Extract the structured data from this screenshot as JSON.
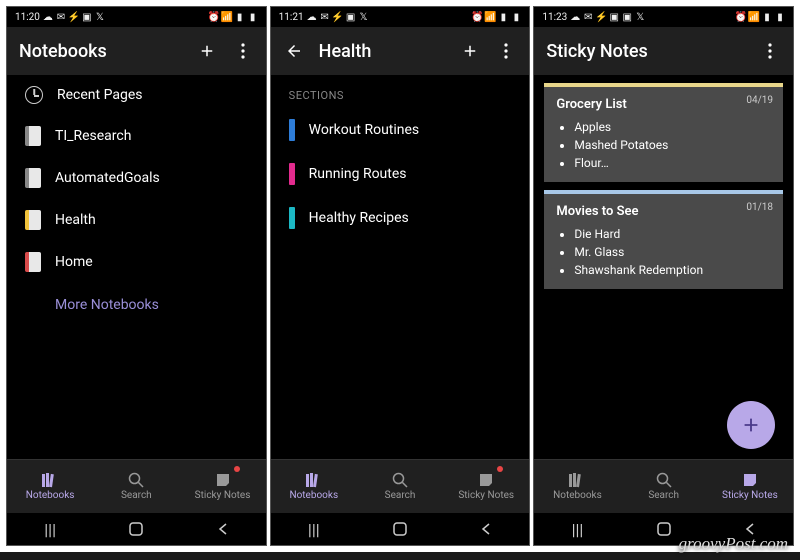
{
  "watermark": "groovyPost.com",
  "screens": {
    "notebooks": {
      "time": "11:20",
      "title": "Notebooks",
      "recent_label": "Recent Pages",
      "items": [
        {
          "label": "TI_Research",
          "color": "gray"
        },
        {
          "label": "AutomatedGoals",
          "color": "gray"
        },
        {
          "label": "Health",
          "color": "yellow"
        },
        {
          "label": "Home",
          "color": "red"
        }
      ],
      "more_label": "More Notebooks",
      "bottom": {
        "active": "notebooks"
      }
    },
    "health": {
      "time": "11:21",
      "title": "Health",
      "sections_label": "SECTIONS",
      "sections": [
        {
          "label": "Workout Routines",
          "color": "blue"
        },
        {
          "label": "Running Routes",
          "color": "magenta"
        },
        {
          "label": "Healthy Recipes",
          "color": "cyan"
        }
      ],
      "bottom": {
        "active": "notebooks"
      }
    },
    "sticky": {
      "time": "11:23",
      "title": "Sticky Notes",
      "notes": [
        {
          "title": "Grocery List",
          "date": "04/19",
          "color": "yellow",
          "items": [
            "Apples",
            "Mashed Potatoes",
            "Flour…"
          ]
        },
        {
          "title": "Movies to See",
          "date": "01/18",
          "color": "blue",
          "items": [
            "Die Hard",
            "Mr. Glass",
            "Shawshank Redemption"
          ]
        }
      ],
      "bottom": {
        "active": "sticky"
      }
    }
  },
  "bottomnav": {
    "notebooks": "Notebooks",
    "search": "Search",
    "sticky": "Sticky Notes"
  }
}
